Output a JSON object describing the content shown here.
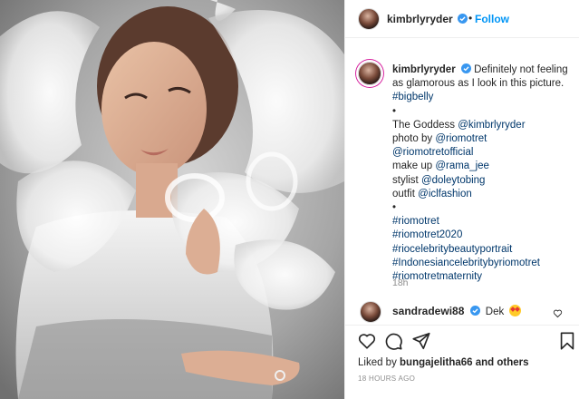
{
  "header": {
    "username": "kimbrlyryder",
    "separator": "•",
    "follow_label": "Follow"
  },
  "caption": {
    "username": "kimbrlyryder",
    "text": "Definitely not feeling as glamorous as I look in this picture.",
    "lines": [
      {
        "text": "#bigbelly",
        "tag": true
      },
      {
        "text": "•",
        "tag": false
      },
      {
        "text": "The Goddess ",
        "mention": "@kimbrlyryder"
      },
      {
        "text": "photo by ",
        "mention": "@riomotret"
      },
      {
        "text": "",
        "mention": "@riomotretofficial"
      },
      {
        "text": "make up ",
        "mention": "@rama_jee"
      },
      {
        "text": "stylist ",
        "mention": "@doleytobing"
      },
      {
        "text": "outfit ",
        "mention": "@iclfashion"
      },
      {
        "text": "•",
        "tag": false
      },
      {
        "text": "#riomotret",
        "tag": true
      },
      {
        "text": "#riomotret2020",
        "tag": true
      },
      {
        "text": "#riocelebritybeautyportrait",
        "tag": true
      },
      {
        "text": "#Indonesiancelebritybyriomotret",
        "tag": true
      },
      {
        "text": "#riomotretmaternity",
        "tag": true
      }
    ],
    "time_ago": "18h"
  },
  "comment": {
    "username": "sandradewi88",
    "text": "Dek"
  },
  "actions": {
    "liked_by_prefix": "Liked by ",
    "liked_by_user": "bungajelitha66",
    "liked_by_suffix": " and others",
    "timestamp": "18 HOURS AGO"
  },
  "icons": {
    "verified": "verified-badge-icon",
    "like": "heart-icon",
    "comment": "comment-bubble-icon",
    "share": "paper-plane-icon",
    "save": "bookmark-icon"
  },
  "colors": {
    "link_blue": "#0095f6",
    "tag_blue": "#00376b",
    "muted_gray": "#8e8e8e",
    "text": "#262626"
  }
}
